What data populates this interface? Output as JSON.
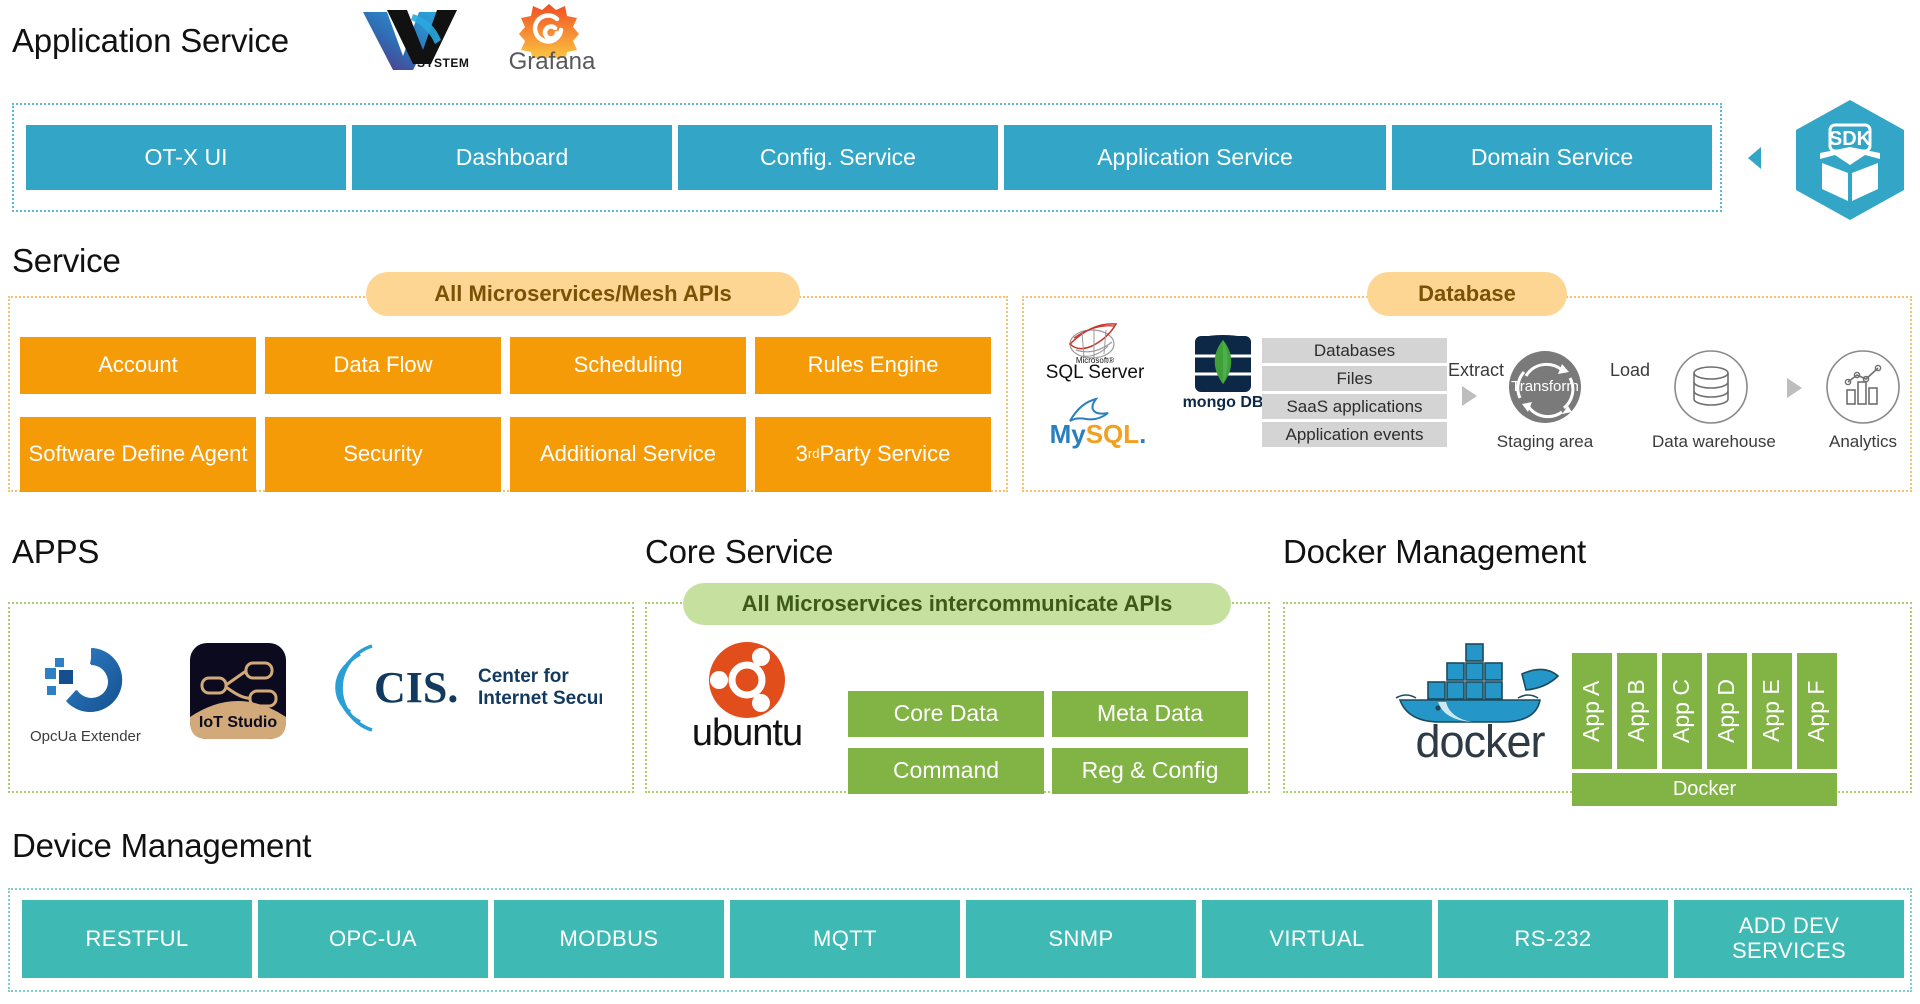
{
  "application_service": {
    "title": "Application Service",
    "logos": [
      {
        "name": "vv-system-logo",
        "label": "SYSTEM"
      },
      {
        "name": "grafana-logo",
        "label": "Grafana"
      }
    ],
    "tiles": [
      "OT-X UI",
      "Dashboard",
      "Config. Service",
      "Application Service",
      "Domain Service"
    ],
    "sdk_badge": "SDK"
  },
  "service": {
    "title": "Service",
    "pill": "All Microservices/Mesh APIs",
    "tiles_row1": [
      "Account",
      "Data Flow",
      "Scheduling",
      "Rules Engine"
    ],
    "tiles_row2": [
      "Software Define Agent",
      "Security",
      "Additional Service",
      "3rd Party Service"
    ],
    "third_party_prefix": "3",
    "third_party_sup": "rd",
    "third_party_suffix": " Party Service"
  },
  "database": {
    "pill": "Database",
    "logos": [
      {
        "name": "microsoft-sql-server-logo",
        "line1": "Microsoft®",
        "line2": "SQL Server"
      },
      {
        "name": "mysql-logo",
        "label": "MySQL"
      },
      {
        "name": "mongodb-logo",
        "label": "mongo DB"
      }
    ],
    "sources": [
      "Databases",
      "Files",
      "SaaS applications",
      "Application events"
    ],
    "flow": {
      "extract_label": "Extract",
      "load_label": "Load",
      "transform_label": "Transform",
      "staging_caption": "Staging area",
      "warehouse_caption": "Data warehouse",
      "analytics_caption": "Analytics"
    }
  },
  "apps": {
    "title": "APPS",
    "items": [
      {
        "name": "opcua-extender-logo",
        "caption": "OpcUa Extender"
      },
      {
        "name": "iot-studio-logo",
        "caption": "IoT Studio"
      },
      {
        "name": "cis-logo",
        "abbr": "CIS",
        "line1": "Center for",
        "line2": "Internet Security®"
      }
    ]
  },
  "core_service": {
    "title": "Core Service",
    "pill": "All Microservices intercommunicate APIs",
    "os_logo": "ubuntu",
    "tiles": [
      "Core Data",
      "Meta Data",
      "Command",
      "Reg & Config"
    ]
  },
  "docker_management": {
    "title": "Docker Management",
    "logo_label": "docker",
    "apps": [
      "App A",
      "App B",
      "App C",
      "App D",
      "App E",
      "App F"
    ],
    "base_label": "Docker"
  },
  "device_management": {
    "title": "Device Management",
    "tiles": [
      "RESTFUL",
      "OPC-UA",
      "MODBUS",
      "MQTT",
      "SNMP",
      "VIRTUAL",
      "RS-232",
      "ADD DEV SERVICES"
    ],
    "last_tile_line1": "ADD DEV",
    "last_tile_line2": "SERVICES"
  },
  "colors": {
    "blue": "#33a6c8",
    "orange": "#f59b08",
    "green": "#82b345",
    "teal": "#3fb9b3",
    "pill_orange": "#fdd694",
    "pill_green": "#c6e0a0"
  }
}
